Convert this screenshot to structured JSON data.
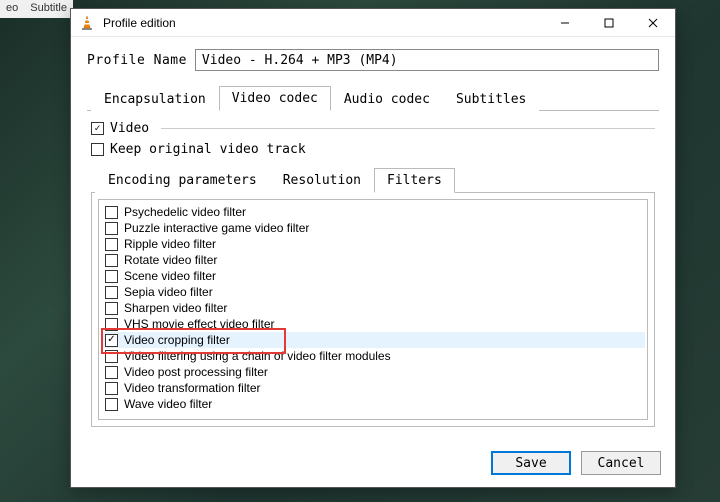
{
  "bg_menu": {
    "item1": "eo",
    "item2": "Subtitle"
  },
  "dialog": {
    "title": "Profile edition",
    "profile_label": "Profile Name",
    "profile_value": "Video - H.264 + MP3 (MP4)",
    "tabs": {
      "encapsulation": "Encapsulation",
      "video_codec": "Video codec",
      "audio_codec": "Audio codec",
      "subtitles": "Subtitles"
    },
    "video_group": {
      "video_label": "Video",
      "video_checked": true,
      "keep_label": "Keep original video track",
      "keep_checked": false
    },
    "sub_tabs": {
      "encoding": "Encoding parameters",
      "resolution": "Resolution",
      "filters": "Filters"
    },
    "filters": [
      {
        "label": "Psychedelic video filter",
        "checked": false,
        "selected": false
      },
      {
        "label": "Puzzle interactive game video filter",
        "checked": false,
        "selected": false
      },
      {
        "label": "Ripple video filter",
        "checked": false,
        "selected": false
      },
      {
        "label": "Rotate video filter",
        "checked": false,
        "selected": false
      },
      {
        "label": "Scene video filter",
        "checked": false,
        "selected": false
      },
      {
        "label": "Sepia video filter",
        "checked": false,
        "selected": false
      },
      {
        "label": "Sharpen video filter",
        "checked": false,
        "selected": false
      },
      {
        "label": "VHS movie effect video filter",
        "checked": false,
        "selected": false
      },
      {
        "label": "Video cropping filter",
        "checked": true,
        "selected": true
      },
      {
        "label": "Video filtering using a chain of video filter modules",
        "checked": false,
        "selected": false
      },
      {
        "label": "Video post processing filter",
        "checked": false,
        "selected": false
      },
      {
        "label": "Video transformation filter",
        "checked": false,
        "selected": false
      },
      {
        "label": "Wave video filter",
        "checked": false,
        "selected": false
      }
    ],
    "buttons": {
      "save": "Save",
      "cancel": "Cancel"
    }
  }
}
